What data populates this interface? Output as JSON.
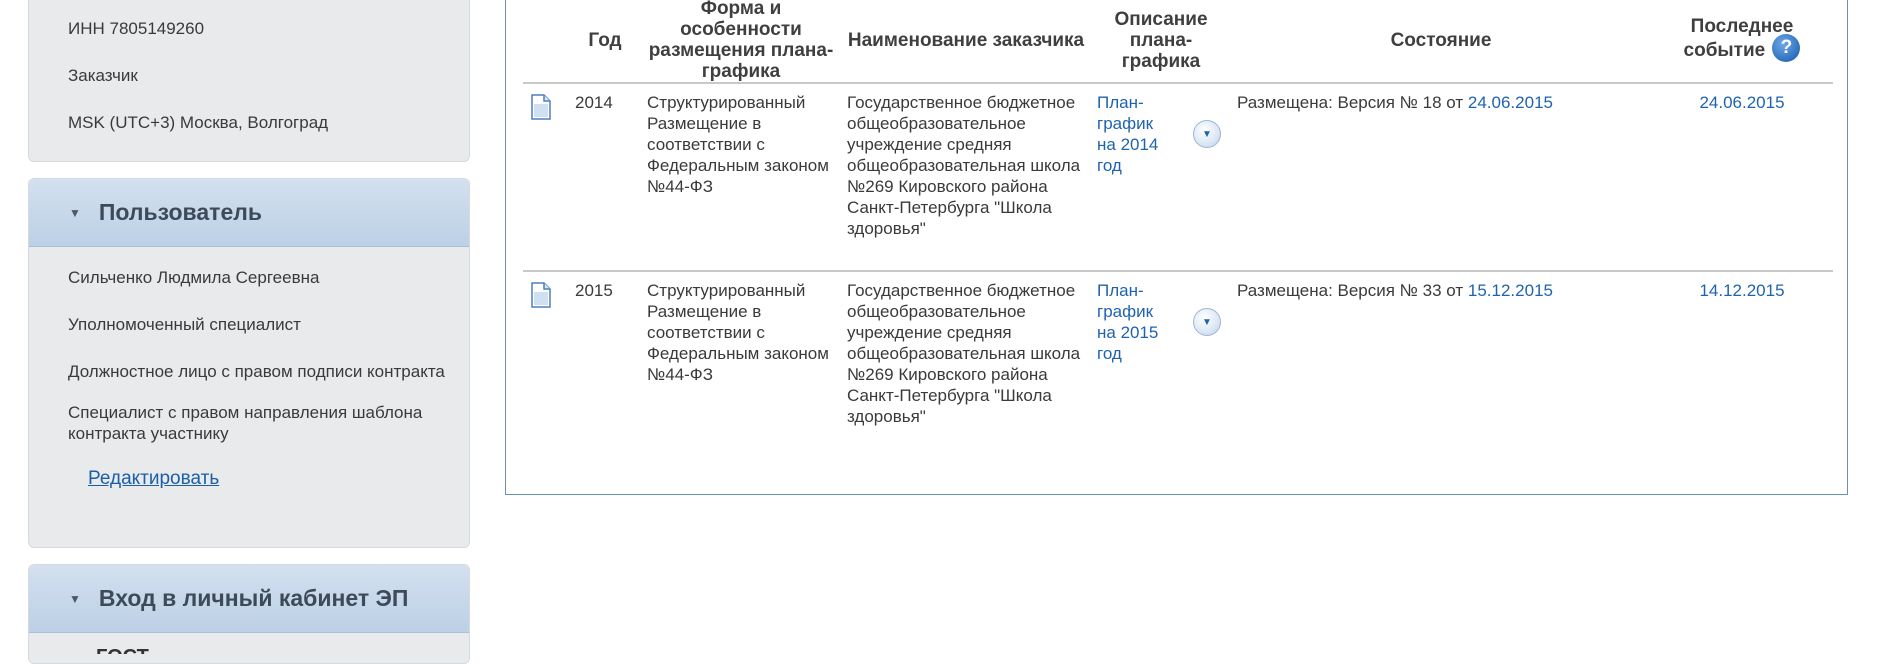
{
  "sidebar": {
    "org": {
      "inn": "ИНН 7805149260",
      "role": "Заказчик",
      "timezone": "MSK (UTC+3) Москва, Волгоград"
    },
    "user_panel": {
      "title": "Пользователь",
      "items": [
        "Сильченко Людмила Сергеевна",
        "Уполномоченный специалист",
        "Должностное лицо с правом подписи контракта",
        "Специалист с правом направления шаблона контракта участнику"
      ],
      "edit_label": "Редактировать"
    },
    "ep_panel": {
      "title": "Вход в личный кабинет ЭП",
      "cut_text": "ГОСТ"
    }
  },
  "table": {
    "headers": {
      "year": "Год",
      "form": "Форма и особенности размещения плана-графика",
      "customer": "Наименование заказчика",
      "description": "Описание плана-графика",
      "state": "Состояние",
      "last_event": "Последнее событие"
    },
    "rows": [
      {
        "year": "2014",
        "form": "Структурированный Размещение в соответствии с Федеральным законом №44-ФЗ",
        "customer": "Государственное бюджетное общеобразовательное учреждение средняя общеобразовательная школа №269 Кировского района Санкт-Петербурга \"Школа здоровья\"",
        "description": "План-график на 2014 год",
        "state_prefix": "Размещена: Версия №  18 от",
        "state_date": "24.06.2015",
        "last_event": "24.06.2015"
      },
      {
        "year": "2015",
        "form": "Структурированный Размещение в соответствии с Федеральным законом №44-ФЗ",
        "customer": "Государственное бюджетное общеобразовательное учреждение средняя общеобразовательная школа №269 Кировского района Санкт-Петербурга \"Школа здоровья\"",
        "description": "План-график на 2015 год",
        "state_prefix": "Размещена: Версия №  33 от",
        "state_date": "15.12.2015",
        "last_event": "14.12.2015"
      }
    ]
  },
  "icons": {
    "document": "document-icon",
    "dropdown": "chevron-down-icon",
    "help": "help-icon",
    "caret": "caret-down-icon"
  },
  "help_glyph": "?",
  "colors": {
    "link": "#1f63ae",
    "panel_header": "#c6d7ea",
    "border": "#6c8fb8"
  }
}
